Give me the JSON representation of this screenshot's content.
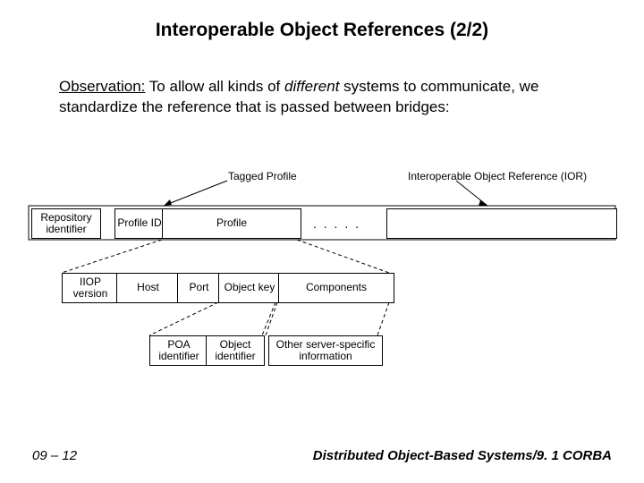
{
  "title": "Interoperable Object References (2/2)",
  "observation": {
    "label": "Observation:",
    "text_before_italic": " To allow all kinds of ",
    "italic_word": "different",
    "text_after_italic": " systems to communicate, we standardize the reference that is passed between bridges:"
  },
  "diagram": {
    "label_tagged_profile": "Tagged Profile",
    "label_ior": "Interoperable Object Reference (IOR)",
    "row1": {
      "repository_identifier": "Repository identifier",
      "profile_id": "Profile ID",
      "profile": "Profile",
      "dots": ".   .   .   .   ."
    },
    "row2": {
      "iiop_version": "IIOP version",
      "host": "Host",
      "port": "Port",
      "object_key": "Object key",
      "components": "Components"
    },
    "row3": {
      "poa_identifier": "POA identifier",
      "object_identifier": "Object identifier",
      "other_info": "Other server-specific information"
    }
  },
  "footer": {
    "left": "09 – 12",
    "right": "Distributed Object-Based Systems/9. 1 CORBA"
  }
}
